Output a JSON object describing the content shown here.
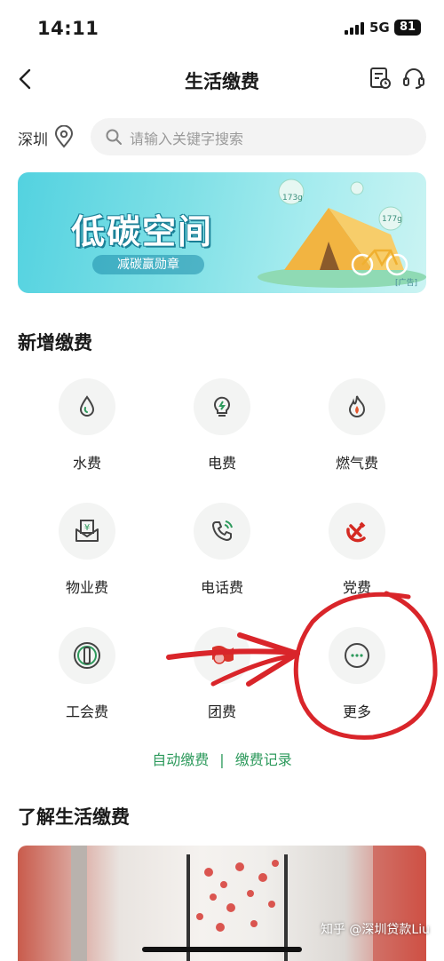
{
  "status": {
    "time": "14:11",
    "network": "5G",
    "battery": "81"
  },
  "nav": {
    "title": "生活缴费"
  },
  "search": {
    "city": "深圳",
    "placeholder": "请输入关键字搜索"
  },
  "banner": {
    "title": "低碳空间",
    "subtitle": "减碳赢勋章",
    "ad_tag": "[广告]",
    "bubbles": [
      "173g",
      "177g"
    ]
  },
  "new_payments": {
    "title": "新增缴费",
    "items": [
      {
        "label": "水费",
        "icon": "water-drop-icon"
      },
      {
        "label": "电费",
        "icon": "lightbulb-icon"
      },
      {
        "label": "燃气费",
        "icon": "flame-icon"
      },
      {
        "label": "物业费",
        "icon": "property-envelope-icon"
      },
      {
        "label": "电话费",
        "icon": "phone-icon"
      },
      {
        "label": "党费",
        "icon": "party-emblem-icon"
      },
      {
        "label": "工会费",
        "icon": "union-badge-icon"
      },
      {
        "label": "团费",
        "icon": "league-flag-icon"
      },
      {
        "label": "更多",
        "icon": "more-dots-icon"
      }
    ]
  },
  "links": {
    "auto_pay": "自动缴费",
    "separator": "|",
    "records": "缴费记录"
  },
  "learn": {
    "title": "了解生活缴费"
  },
  "watermark": "知乎 @深圳贷款Liu",
  "colors": {
    "accent_green": "#2d9a5c",
    "annotation_red": "#d9252a"
  }
}
